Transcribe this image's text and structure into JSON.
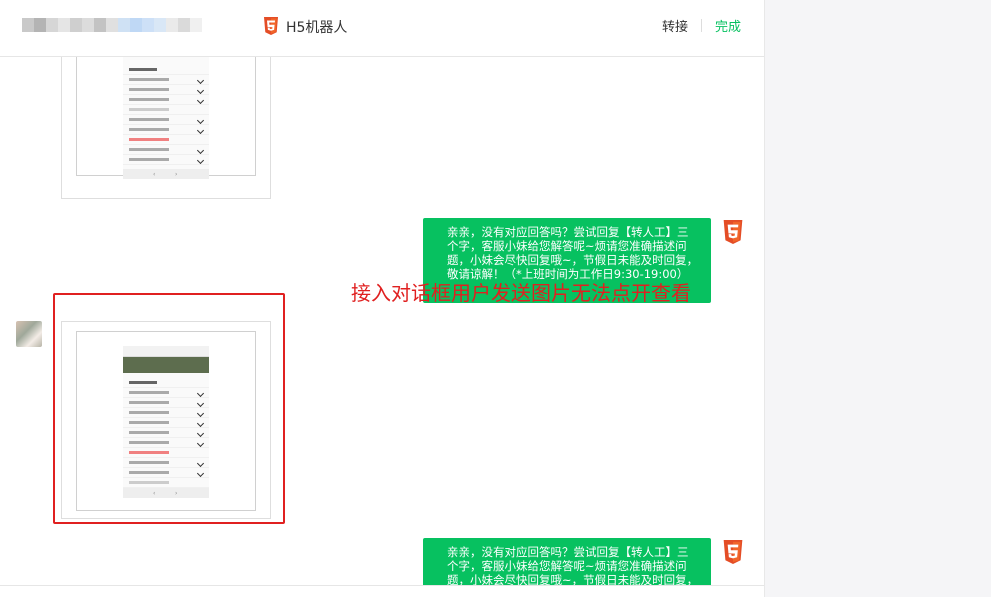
{
  "header": {
    "bot_name": "H5机器人",
    "transfer_label": "转接",
    "done_label": "完成"
  },
  "messages": {
    "bot_reply_text": "亲亲，没有对应回答吗？尝试回复【转人工】三个字，客服小妹给您解答呢~烦请您准确描述问题，小妹会尽快回复哦~，节假日未能及时回复，敬请谅解！（*上班时间为工作日9:30-19:00）"
  },
  "annotation": {
    "text": "接入对话框用户发送图片无法点开查看"
  },
  "icons": {
    "bot_avatar": "html5-icon",
    "channel_badge": "html5-icon"
  },
  "colors": {
    "accent_green": "#07c160",
    "annotation_red": "#e02020"
  }
}
